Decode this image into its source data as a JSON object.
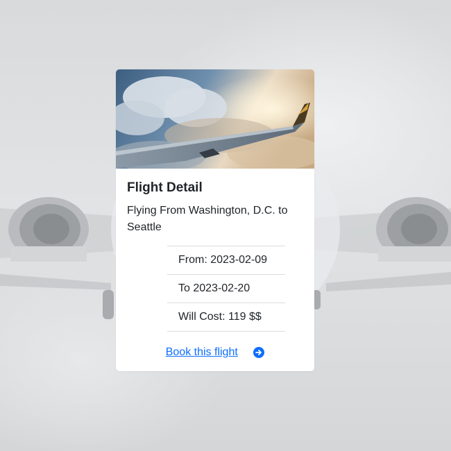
{
  "card": {
    "title": "Flight Detail",
    "description": "Flying From Washington, D.C. to Seattle",
    "details": [
      "From: 2023-02-09",
      "To 2023-02-20",
      "Will Cost: 119 $$"
    ],
    "book_link_label": "Book this flight",
    "book_icon": "arrow-right-circle-icon"
  },
  "colors": {
    "link": "#0d6efd",
    "text": "#212529",
    "divider": "#d9dcdf",
    "card_background": "#ffffff"
  }
}
